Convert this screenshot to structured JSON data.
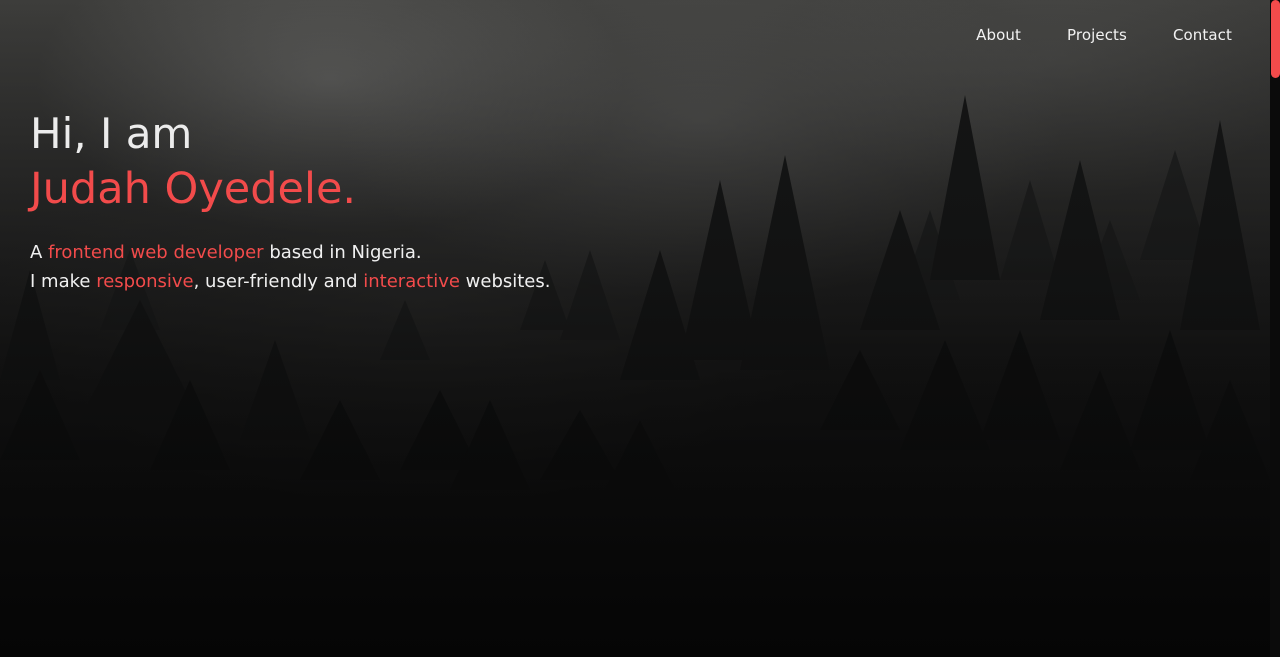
{
  "nav": {
    "items": [
      {
        "label": "About"
      },
      {
        "label": "Projects"
      },
      {
        "label": "Contact"
      }
    ]
  },
  "hero": {
    "greeting": "Hi, I am",
    "name": "Judah Oyedele.",
    "line1": {
      "prefix": "A ",
      "highlight": "frontend web developer",
      "suffix": " based in Nigeria."
    },
    "line2": {
      "prefix": "I make ",
      "highlight1": "responsive",
      "middle": ", user-friendly and ",
      "highlight2": "interactive",
      "suffix": " websites."
    }
  },
  "colors": {
    "accent": "#f24b4b",
    "text": "#f0f0f0",
    "background": "#0a0a0a"
  }
}
